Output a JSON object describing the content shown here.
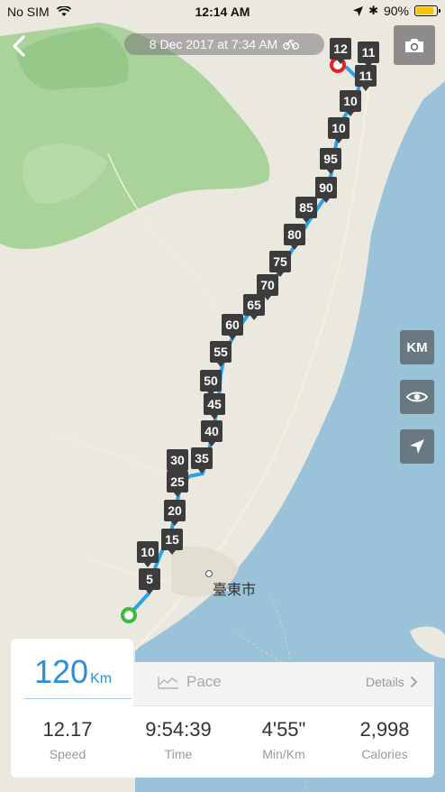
{
  "status": {
    "carrier": "No SIM",
    "time": "12:14 AM",
    "battery": "90%",
    "battery_level": 0.9
  },
  "header": {
    "date": "8 Dec 2017 at 7:34 AM",
    "back_icon": "chevron-left-icon",
    "activity_icon": "bicycle-icon",
    "camera_icon": "camera-icon"
  },
  "side_buttons": {
    "units": "KM",
    "view_icon": "eye-icon",
    "locate_icon": "location-arrow-icon"
  },
  "map": {
    "city_label": "臺東市",
    "route_color": "#29a3e6",
    "start_color": "#3cba3c",
    "end_color": "#e0242b",
    "km_markers": [
      "5",
      "10",
      "15",
      "20",
      "25",
      "30",
      "35",
      "40",
      "45",
      "50",
      "55",
      "60",
      "65",
      "70",
      "75",
      "80",
      "85",
      "90",
      "95",
      "10",
      "10",
      "11",
      "11",
      "12"
    ]
  },
  "summary": {
    "distance": "120",
    "distance_unit": "Km",
    "pace_tab": "Pace",
    "details": "Details",
    "stats": [
      {
        "value": "12.17",
        "label": "Speed"
      },
      {
        "value": "9:54:39",
        "label": "Time"
      },
      {
        "value": "4'55\"",
        "label": "Min/Km"
      },
      {
        "value": "2,998",
        "label": "Calories"
      }
    ]
  }
}
